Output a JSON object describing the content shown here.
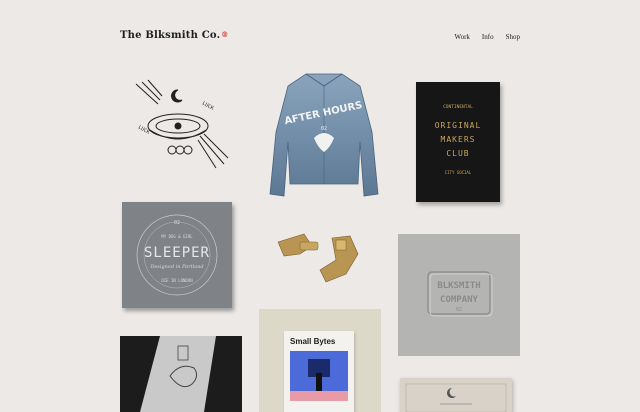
{
  "brand": {
    "name": "The Blksmith Co.",
    "reg": "®"
  },
  "nav": [
    {
      "label": "Work"
    },
    {
      "label": "Info"
    },
    {
      "label": "Shop"
    }
  ],
  "tiles": {
    "t1": {
      "words": [
        "LUCK",
        "LUCK"
      ]
    },
    "t2": {
      "text": "AFTER HOURS",
      "number": "02"
    },
    "t3": {
      "lines": [
        "CONTINENTAL",
        "ORIGINAL",
        "MAKERS",
        "CLUB",
        "CITY SOCIAL"
      ]
    },
    "t4": {
      "top": "MY DOG & GIRL",
      "title": "SLEEPER",
      "script": "Designed in Portland",
      "sub": "DIE IN LONDON",
      "num": "02"
    },
    "t6": {
      "line1": "BLKSMITH",
      "line2": "COMPANY",
      "num": "02"
    },
    "t8": {
      "title": "Small Bytes"
    }
  },
  "colors": {
    "accent": "#d2322d",
    "gold": "#c8a45c"
  }
}
